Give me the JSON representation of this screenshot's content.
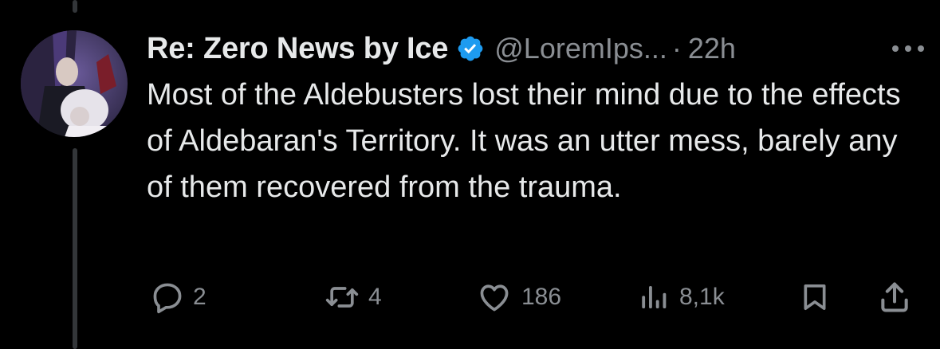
{
  "tweet": {
    "display_name": "Re: Zero News by Ice",
    "verified": true,
    "handle": "@LoremIps...",
    "separator": "·",
    "timestamp": "22h",
    "text": "Most of the Aldebusters lost their mind due to the effects of Aldebaran's Territory. It was an utter mess, barely any of them recovered from the trauma."
  },
  "actions": {
    "replies": "2",
    "reposts": "4",
    "likes": "186",
    "views": "8,1k"
  },
  "icons": {
    "verified": "verified-badge-icon",
    "more": "more-options-icon",
    "reply": "reply-icon",
    "repost": "repost-icon",
    "like": "heart-icon",
    "views": "views-chart-icon",
    "bookmark": "bookmark-icon",
    "share": "share-icon"
  },
  "colors": {
    "background": "#000000",
    "text_primary": "#e7e9ea",
    "text_secondary": "#8a8e93",
    "verified_blue": "#1d9bf0",
    "thread_line": "#333639"
  }
}
